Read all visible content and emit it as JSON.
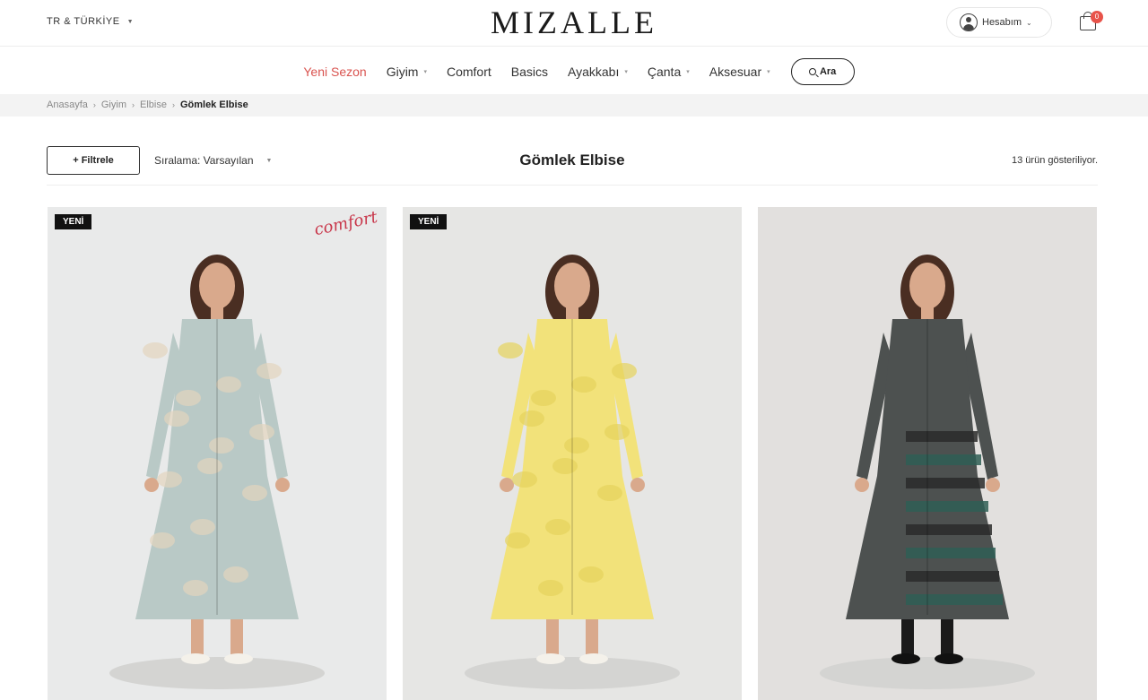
{
  "header": {
    "region": "TR & TÜRKİYE",
    "logo": "MIZALLE",
    "account_label": "Hesabım",
    "cart_count": "0"
  },
  "nav": {
    "items": [
      {
        "label": "Yeni Sezon",
        "active": true,
        "has_dropdown": false
      },
      {
        "label": "Giyim",
        "active": false,
        "has_dropdown": true
      },
      {
        "label": "Comfort",
        "active": false,
        "has_dropdown": false
      },
      {
        "label": "Basics",
        "active": false,
        "has_dropdown": false
      },
      {
        "label": "Ayakkabı",
        "active": false,
        "has_dropdown": true
      },
      {
        "label": "Çanta",
        "active": false,
        "has_dropdown": true
      },
      {
        "label": "Aksesuar",
        "active": false,
        "has_dropdown": true
      }
    ],
    "search_label": "Ara"
  },
  "breadcrumb": [
    "Anasayfa",
    "Giyim",
    "Elbise",
    "Gömlek Elbise"
  ],
  "toolbar": {
    "filter_label": "+ Filtrele",
    "sort_label": "Sıralama: Varsayılan",
    "title": "Gömlek Elbise",
    "count_text": "13 ürün gösteriliyor."
  },
  "products": [
    {
      "badge": "YENİ",
      "extra_logo": "comfort",
      "dress_color": "#b9c9c6",
      "accent": "#e2d4bd",
      "bg": "#e9eaea"
    },
    {
      "badge": "YENİ",
      "extra_logo": "",
      "dress_color": "#f2e27a",
      "accent": "#e6d35c",
      "bg": "#e6e6e4"
    },
    {
      "badge": "",
      "extra_logo": "",
      "dress_color": "#4d5150",
      "accent": "#2f5e55",
      "bg": "#e2e0de"
    }
  ],
  "colors": {
    "accent_red": "#d9534f",
    "cart_badge": "#e8534a"
  }
}
